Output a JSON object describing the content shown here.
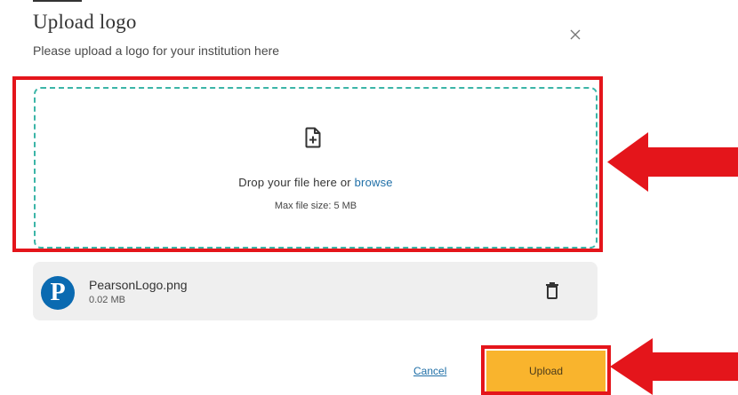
{
  "dialog": {
    "title": "Upload logo",
    "subtitle": "Please upload a logo for your institution here",
    "close_icon": "close-icon"
  },
  "dropzone": {
    "icon": "file-add-icon",
    "prompt": "Drop your file here or ",
    "browse_label": "browse",
    "max_size": "Max file size: 5 MB"
  },
  "file": {
    "logo_letter": "P",
    "name": "PearsonLogo.png",
    "size": "0.02 MB",
    "delete_icon": "trash-icon"
  },
  "actions": {
    "cancel_label": "Cancel",
    "upload_label": "Upload"
  },
  "colors": {
    "annotation_red": "#e4151b",
    "dropzone_border": "#3bb5a7",
    "link": "#1f6fa7",
    "upload_button": "#f9b42d",
    "file_card_bg": "#efefef",
    "logo_blue": "#0a6ab1"
  }
}
